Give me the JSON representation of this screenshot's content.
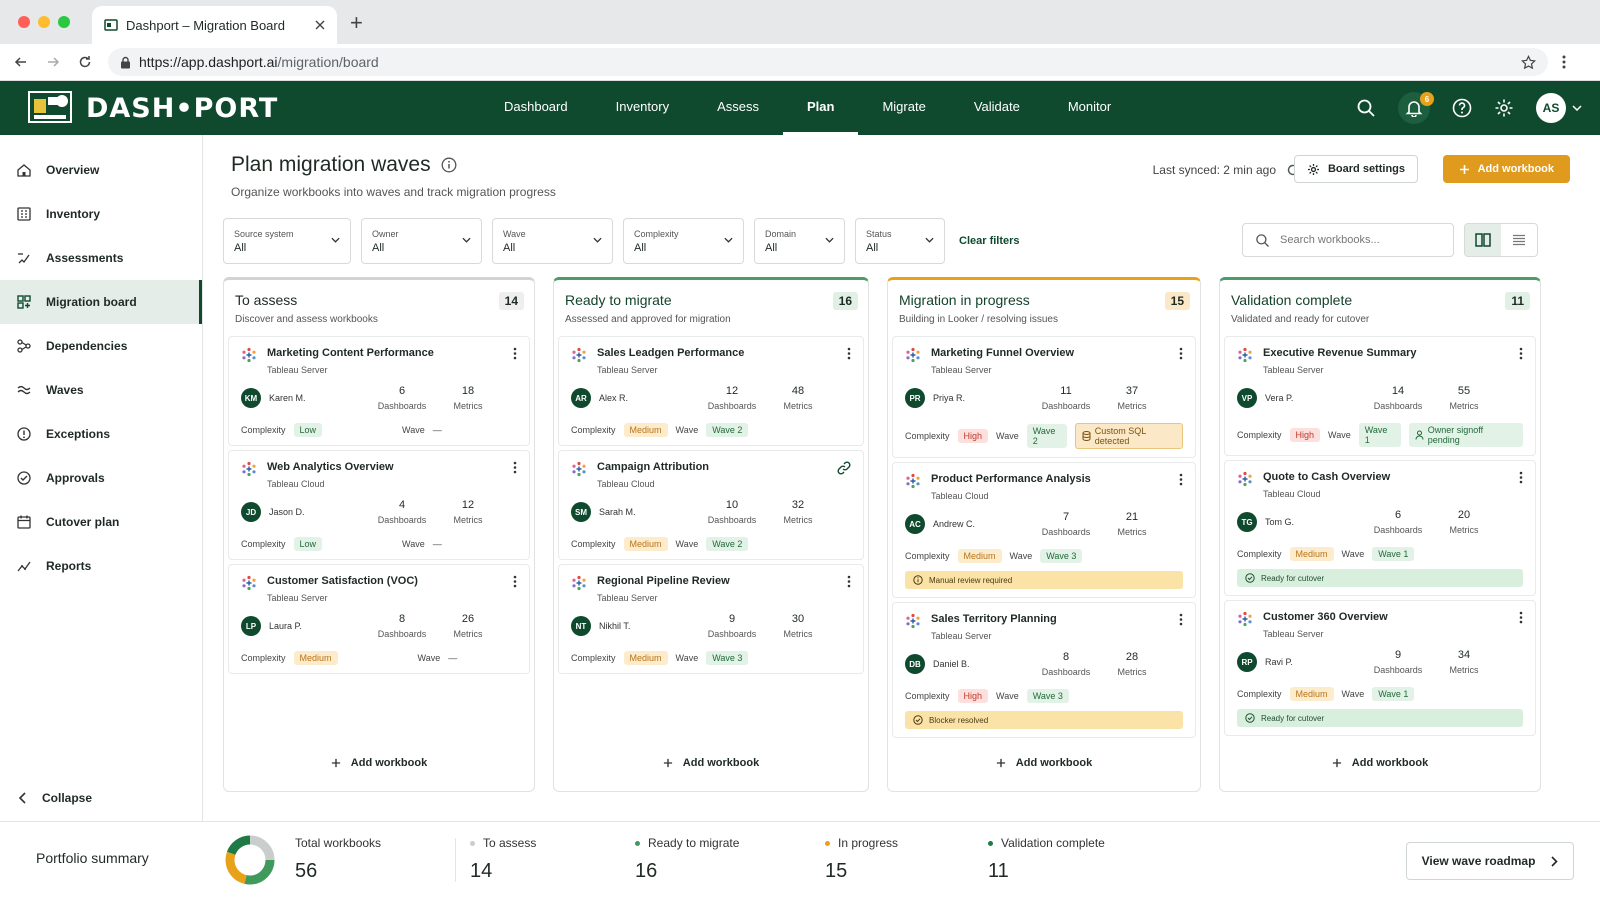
{
  "browser": {
    "tab_title": "Dashport – Migration Board",
    "url_host": "https://app.dashport.ai",
    "url_path": "/migration/board"
  },
  "app": {
    "logo_text": "DASH•PORT",
    "nav": [
      "Dashboard",
      "Inventory",
      "Assess",
      "Plan",
      "Migrate",
      "Validate",
      "Monitor"
    ],
    "active_nav": "Plan",
    "notifications": "6",
    "user_initials": "AS"
  },
  "sidebar": {
    "items": [
      {
        "label": "Overview",
        "icon": "home-icon"
      },
      {
        "label": "Inventory",
        "icon": "inventory-icon"
      },
      {
        "label": "Assessments",
        "icon": "assess-icon"
      },
      {
        "label": "Migration board",
        "icon": "board-icon",
        "active": true
      },
      {
        "label": "Dependencies",
        "icon": "dependencies-icon"
      },
      {
        "label": "Waves",
        "icon": "waves-icon"
      },
      {
        "label": "Exceptions",
        "icon": "exceptions-icon"
      },
      {
        "label": "Approvals",
        "icon": "approvals-icon"
      },
      {
        "label": "Cutover plan",
        "icon": "calendar-icon"
      },
      {
        "label": "Reports",
        "icon": "reports-icon"
      }
    ],
    "collapse_label": "Collapse"
  },
  "page": {
    "title": "Plan migration waves",
    "subtitle": "Organize workbooks into waves and track migration progress",
    "last_synced": "Last synced: 2 min ago",
    "board_settings": "Board settings",
    "add_workbook": "Add workbook"
  },
  "filters": {
    "items": [
      {
        "label": "Source system",
        "value": "All"
      },
      {
        "label": "Owner",
        "value": "All"
      },
      {
        "label": "Wave",
        "value": "All"
      },
      {
        "label": "Complexity",
        "value": "All"
      },
      {
        "label": "Domain",
        "value": "All"
      },
      {
        "label": "Status",
        "value": "All"
      }
    ],
    "clear": "Clear filters",
    "search_placeholder": "Search workbooks..."
  },
  "board": {
    "labels": {
      "dashboards": "Dashboards",
      "metrics": "Metrics",
      "complexity": "Complexity",
      "wave": "Wave",
      "add": "Add workbook"
    },
    "columns": [
      {
        "title": "To assess",
        "subtitle": "Discover and assess workbooks",
        "count": "14",
        "cards": [
          {
            "name": "Marketing Content Performance",
            "source": "Tableau Server",
            "initials": "KM",
            "owner": "Karen M.",
            "dashboards": "6",
            "metrics": "18",
            "complexity": "Low",
            "wave": "—"
          },
          {
            "name": "Web Analytics Overview",
            "source": "Tableau Cloud",
            "initials": "JD",
            "owner": "Jason D.",
            "dashboards": "4",
            "metrics": "12",
            "complexity": "Low",
            "wave": "—"
          },
          {
            "name": "Customer Satisfaction (VOC)",
            "source": "Tableau Server",
            "initials": "LP",
            "owner": "Laura P.",
            "dashboards": "8",
            "metrics": "26",
            "complexity": "Medium",
            "wave": "—"
          }
        ]
      },
      {
        "title": "Ready to migrate",
        "subtitle": "Assessed and approved for migration",
        "count": "16",
        "cards": [
          {
            "name": "Sales Leadgen Performance",
            "source": "Tableau Server",
            "initials": "AR",
            "owner": "Alex R.",
            "dashboards": "12",
            "metrics": "48",
            "complexity": "Medium",
            "wave": "Wave 2"
          },
          {
            "name": "Campaign Attribution",
            "source": "Tableau Cloud",
            "initials": "SM",
            "owner": "Sarah M.",
            "dashboards": "10",
            "metrics": "32",
            "complexity": "Medium",
            "wave": "Wave 2"
          },
          {
            "name": "Regional Pipeline Review",
            "source": "Tableau Server",
            "initials": "NT",
            "owner": "Nikhil T.",
            "dashboards": "9",
            "metrics": "30",
            "complexity": "Medium",
            "wave": "Wave 3"
          }
        ]
      },
      {
        "title": "Migration in progress",
        "subtitle": "Building in Looker / resolving issues",
        "count": "15",
        "cards": [
          {
            "name": "Marketing Funnel Overview",
            "source": "Tableau Server",
            "initials": "PR",
            "owner": "Priya R.",
            "dashboards": "11",
            "metrics": "37",
            "complexity": "High",
            "wave": "Wave 2",
            "tag": "Custom SQL detected"
          },
          {
            "name": "Product Performance Analysis",
            "source": "Tableau Cloud",
            "initials": "AC",
            "owner": "Andrew C.",
            "dashboards": "7",
            "metrics": "21",
            "complexity": "Medium",
            "wave": "Wave 3",
            "banner": "Manual review required"
          },
          {
            "name": "Sales Territory Planning",
            "source": "Tableau Server",
            "initials": "DB",
            "owner": "Daniel B.",
            "dashboards": "8",
            "metrics": "28",
            "complexity": "High",
            "wave": "Wave 3",
            "banner": "Blocker resolved"
          }
        ]
      },
      {
        "title": "Validation complete",
        "subtitle": "Validated and ready for cutover",
        "count": "11",
        "cards": [
          {
            "name": "Executive Revenue Summary",
            "source": "Tableau Server",
            "initials": "VP",
            "owner": "Vera P.",
            "dashboards": "14",
            "metrics": "55",
            "complexity": "High",
            "wave": "Wave 1",
            "tag": "Owner signoff pending"
          },
          {
            "name": "Quote to Cash Overview",
            "source": "Tableau Cloud",
            "initials": "TG",
            "owner": "Tom G.",
            "dashboards": "6",
            "metrics": "20",
            "complexity": "Medium",
            "wave": "Wave 1",
            "banner": "Ready for cutover"
          },
          {
            "name": "Customer 360 Overview",
            "source": "Tableau Server",
            "initials": "RP",
            "owner": "Ravi P.",
            "dashboards": "9",
            "metrics": "34",
            "complexity": "Medium",
            "wave": "Wave 1",
            "banner": "Ready for cutover"
          }
        ]
      }
    ]
  },
  "summary": {
    "title": "Portfolio summary",
    "total_label": "Total workbooks",
    "total": "56",
    "stats": [
      {
        "label": "To assess",
        "value": "14",
        "color": "#c9cdcb"
      },
      {
        "label": "Ready to migrate",
        "value": "16",
        "color": "#3f9a5c"
      },
      {
        "label": "In progress",
        "value": "15",
        "color": "#e8a21a"
      },
      {
        "label": "Validation complete",
        "value": "11",
        "color": "#1f7a45"
      }
    ],
    "roadmap_button": "View wave roadmap"
  },
  "colors": {
    "brand": "#0f4a2f",
    "accent": "#e09a1e"
  }
}
